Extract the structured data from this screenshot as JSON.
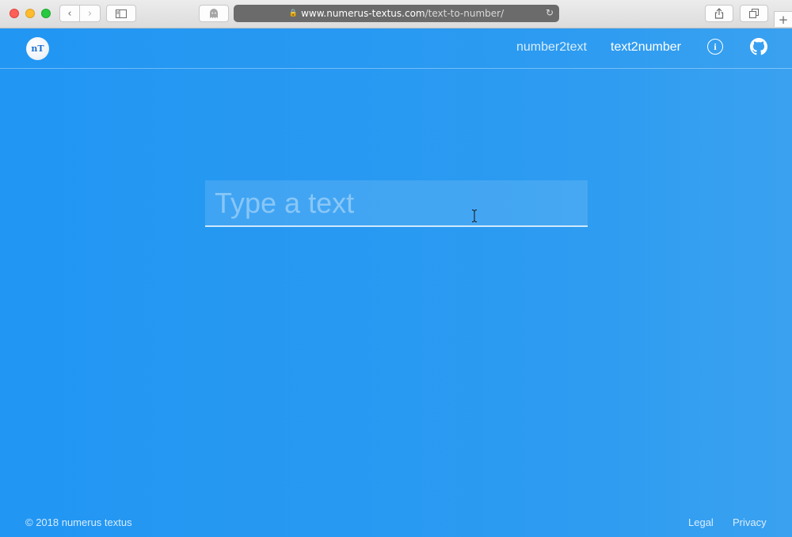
{
  "browser": {
    "url_host": "www.numerus-textus.com",
    "url_path": "/text-to-number/",
    "lock_glyph": "🔒",
    "back_glyph": "‹",
    "forward_glyph": "›",
    "reload_glyph": "↻",
    "plus_glyph": "+"
  },
  "header": {
    "logo_text": "nT",
    "nav": [
      {
        "label": "number2text",
        "active": false
      },
      {
        "label": "text2number",
        "active": true
      }
    ],
    "info_glyph": "i"
  },
  "main": {
    "input_placeholder": "Type a text",
    "input_value": ""
  },
  "footer": {
    "copyright": "© 2018 numerus textus",
    "links": [
      "Legal",
      "Privacy"
    ]
  },
  "colors": {
    "background": "#2196f3",
    "text": "#ffffff"
  }
}
